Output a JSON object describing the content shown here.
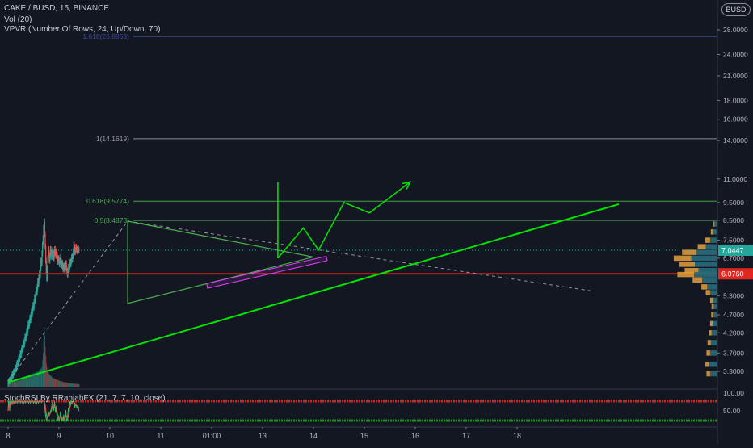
{
  "legend": {
    "symbol": "CAKE / BUSD, 15, BINANCE",
    "vol": "Vol (20)",
    "vpvr": "VPVR (Number Of Rows, 24, Up/Down, 70)",
    "stoch": "StochRSI By RRahjahFX (21, 7, 7, 10, close)"
  },
  "currency_button": "BUSD",
  "colors": {
    "background": "#131722",
    "up": "#26a69a",
    "down": "#ef5350",
    "fib": "#4caf50",
    "trend": "#00e600",
    "support": "#ff1f1f",
    "channel": "#e040fb",
    "vpvr_up": "#2a6b7c",
    "vpvr_down": "#d99a3c",
    "price_tag": "#26a69a"
  },
  "chart_data": {
    "type": "candlestick",
    "symbol": "CAKE / BUSD",
    "interval": "15",
    "exchange": "BINANCE",
    "scale": "log",
    "y_ticks": [
      28.0,
      24.0,
      21.0,
      18.0,
      16.0,
      14.0,
      11.0,
      9.5,
      8.5,
      7.5,
      6.7,
      5.3,
      4.7,
      4.2,
      3.7,
      3.3
    ],
    "y_tick_labels": [
      "28.0000",
      "24.0000",
      "21.0000",
      "18.0000",
      "16.0000",
      "14.0000",
      "11.0000",
      "9.5000",
      "8.5000",
      "7.5000",
      "6.7000",
      "5.3000",
      "4.7000",
      "4.2000",
      "3.7000",
      "3.3000"
    ],
    "x_ticks": [
      8,
      9,
      10,
      11,
      12,
      13,
      14,
      15,
      16,
      17,
      18
    ],
    "x_tick_labels": [
      "8",
      "9",
      "10",
      "11",
      "01:00",
      "13",
      "14",
      "15",
      "16",
      "17",
      "18"
    ],
    "last_price": 7.0447,
    "last_price_label": "7.0447",
    "support_price": 6.076,
    "support_price_label": "6.0760",
    "fib_levels": [
      {
        "ratio": 1.618,
        "price": 26.8853,
        "label": "1.618(26.8853)"
      },
      {
        "ratio": 1,
        "price": 14.1619,
        "label": "1(14.1619)"
      },
      {
        "ratio": 0.618,
        "price": 9.5774,
        "label": "0.618(9.5774)"
      },
      {
        "ratio": 0.5,
        "price": 8.4873,
        "label": "0.5(8.4873)"
      }
    ],
    "trend_line": {
      "start": {
        "day": 8.0,
        "price": 3.08
      },
      "end": {
        "day": 20.0,
        "price": 9.4
      }
    },
    "triangle": {
      "top": {
        "day": 10.35,
        "price": 8.45
      },
      "bottom": {
        "day": 10.35,
        "price": 5.05
      },
      "apex": {
        "day": 14.0,
        "price": 6.75
      }
    },
    "projection_path": [
      {
        "day": 13.3,
        "price": 6.7
      },
      {
        "day": 13.8,
        "price": 8.1
      },
      {
        "day": 14.1,
        "price": 7.05
      },
      {
        "day": 14.6,
        "price": 9.5
      },
      {
        "day": 15.1,
        "price": 8.9
      },
      {
        "day": 15.9,
        "price": 10.8
      }
    ],
    "stoch_levels": [
      "100.00",
      "50.00"
    ],
    "candles": {
      "start_day": 8.0,
      "step_day": 0.0104,
      "close": [
        3.08,
        3.1,
        3.12,
        3.1,
        3.14,
        3.18,
        3.16,
        3.2,
        3.25,
        3.22,
        3.28,
        3.3,
        3.27,
        3.32,
        3.38,
        3.35,
        3.42,
        3.48,
        3.45,
        3.52,
        3.58,
        3.55,
        3.62,
        3.7,
        3.66,
        3.75,
        3.82,
        3.78,
        3.86,
        3.95,
        3.9,
        4.0,
        4.1,
        4.05,
        4.15,
        4.25,
        4.2,
        4.32,
        4.45,
        4.38,
        4.5,
        4.62,
        4.55,
        4.7,
        4.8,
        4.72,
        4.88,
        5.0,
        4.92,
        5.1,
        5.25,
        5.15,
        5.35,
        5.5,
        5.4,
        5.6,
        5.8,
        5.7,
        5.95,
        6.1,
        6.0,
        6.3,
        6.6,
        6.5,
        6.9,
        7.3,
        7.6,
        8.1,
        8.45,
        7.8,
        7.2,
        6.6,
        6.2,
        5.9,
        6.3,
        6.7,
        7.1,
        6.9,
        6.6,
        6.8,
        7.1,
        6.95,
        6.75,
        6.9,
        7.05,
        6.85,
        6.7,
        6.95,
        7.1,
        6.9,
        6.8,
        7.0,
        6.85,
        6.7,
        6.55,
        6.7,
        6.6,
        6.45,
        6.6,
        6.75,
        6.55,
        6.4,
        6.5,
        6.35,
        6.25,
        6.4,
        6.3,
        6.2,
        6.35,
        6.5,
        6.3,
        6.15,
        6.05,
        6.2,
        6.35,
        6.25,
        6.4,
        6.55,
        6.45,
        6.6,
        6.75,
        6.65,
        6.8,
        7.0,
        7.3,
        7.15,
        6.95,
        7.05,
        7.2,
        7.1,
        7.0,
        7.1,
        7.15,
        7.05,
        7.0447
      ],
      "volume": [
        18,
        22,
        15,
        20,
        25,
        19,
        17,
        23,
        21,
        16,
        24,
        26,
        20,
        18,
        27,
        22,
        25,
        29,
        21,
        24,
        28,
        23,
        26,
        31,
        27,
        30,
        33,
        28,
        32,
        35,
        30,
        34,
        38,
        33,
        36,
        40,
        35,
        39,
        42,
        37,
        41,
        45,
        40,
        44,
        47,
        42,
        46,
        50,
        45,
        48,
        52,
        47,
        51,
        55,
        49,
        54,
        58,
        52,
        57,
        61,
        56,
        62,
        68,
        64,
        72,
        95,
        120,
        160,
        210,
        180,
        140,
        110,
        85,
        70,
        60,
        55,
        52,
        48,
        45,
        43,
        41,
        39,
        37,
        35,
        34,
        33,
        32,
        31,
        30,
        29,
        28,
        27,
        26,
        26,
        25,
        24,
        24,
        23,
        22,
        22,
        21,
        21,
        20,
        20,
        19,
        19,
        18,
        18,
        18,
        17,
        17,
        17,
        16,
        16,
        16,
        15,
        15,
        15,
        15,
        14,
        14,
        14,
        14,
        13,
        13,
        13,
        13,
        12,
        12,
        12,
        12,
        12,
        11,
        11,
        11
      ]
    },
    "vpvr_rows": [
      {
        "price": 8.3,
        "up": 6,
        "down": 4
      },
      {
        "price": 7.9,
        "up": 10,
        "down": 6
      },
      {
        "price": 7.5,
        "up": 18,
        "down": 14
      },
      {
        "price": 7.2,
        "up": 30,
        "down": 22
      },
      {
        "price": 6.95,
        "up": 55,
        "down": 40
      },
      {
        "price": 6.7,
        "up": 70,
        "down": 48
      },
      {
        "price": 6.45,
        "up": 60,
        "down": 42
      },
      {
        "price": 6.2,
        "up": 50,
        "down": 38
      },
      {
        "price": 6.05,
        "up": 62,
        "down": 46
      },
      {
        "price": 5.85,
        "up": 40,
        "down": 26
      },
      {
        "price": 5.6,
        "up": 26,
        "down": 16
      },
      {
        "price": 5.4,
        "up": 18,
        "down": 12
      },
      {
        "price": 5.15,
        "up": 10,
        "down": 8
      },
      {
        "price": 4.95,
        "up": 8,
        "down": 6
      },
      {
        "price": 4.7,
        "up": 9,
        "down": 6
      },
      {
        "price": 4.45,
        "up": 11,
        "down": 7
      },
      {
        "price": 4.2,
        "up": 14,
        "down": 8
      },
      {
        "price": 3.95,
        "up": 16,
        "down": 9
      },
      {
        "price": 3.7,
        "up": 18,
        "down": 10
      },
      {
        "price": 3.45,
        "up": 20,
        "down": 11
      },
      {
        "price": 3.25,
        "up": 18,
        "down": 10
      }
    ]
  }
}
